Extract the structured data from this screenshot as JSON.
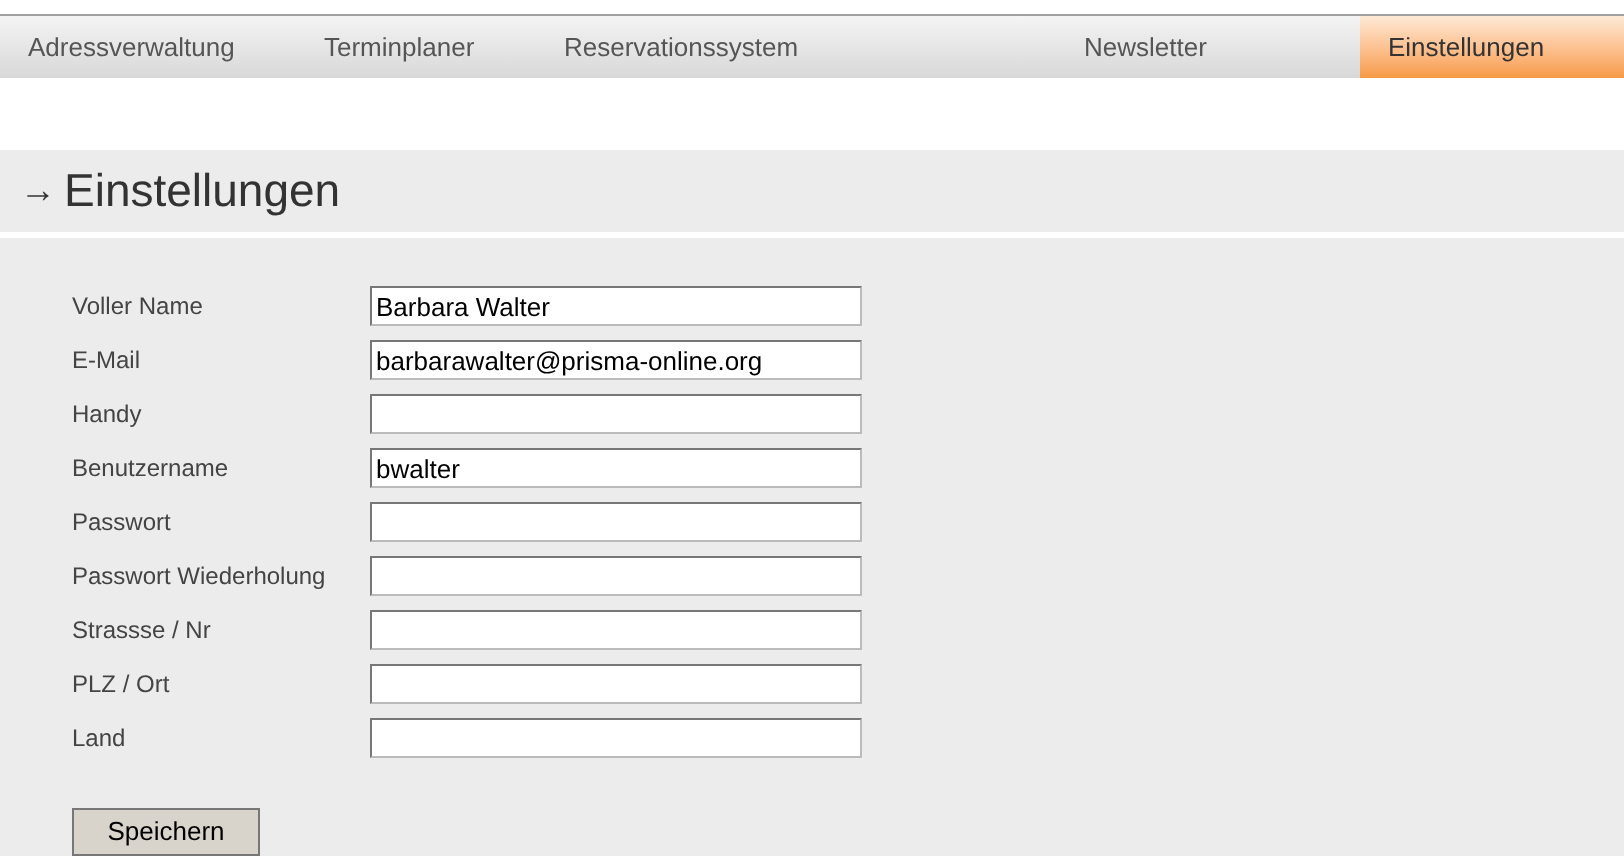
{
  "nav": [
    {
      "label": "Adressverwaltung",
      "selected": false
    },
    {
      "label": "Terminplaner",
      "selected": false
    },
    {
      "label": "Reservationssystem",
      "selected": false
    },
    {
      "label": "Newsletter",
      "selected": false
    },
    {
      "label": "Einstellungen",
      "selected": true
    }
  ],
  "heading": {
    "arrow": "→",
    "title": "Einstellungen"
  },
  "fields": [
    {
      "label": "Voller Name",
      "value": "Barbara Walter"
    },
    {
      "label": "E-Mail",
      "value": "barbarawalter@prisma-online.org"
    },
    {
      "label": "Handy"
    },
    {
      "label": "Benutzername",
      "value": "bwalter"
    },
    {
      "label": "Passwort"
    },
    {
      "label": "Passwort Wiederholung"
    },
    {
      "label": "Strassse / Nr"
    },
    {
      "label": "PLZ / Ort"
    },
    {
      "label": "Land"
    }
  ],
  "save_button": "Speichern"
}
